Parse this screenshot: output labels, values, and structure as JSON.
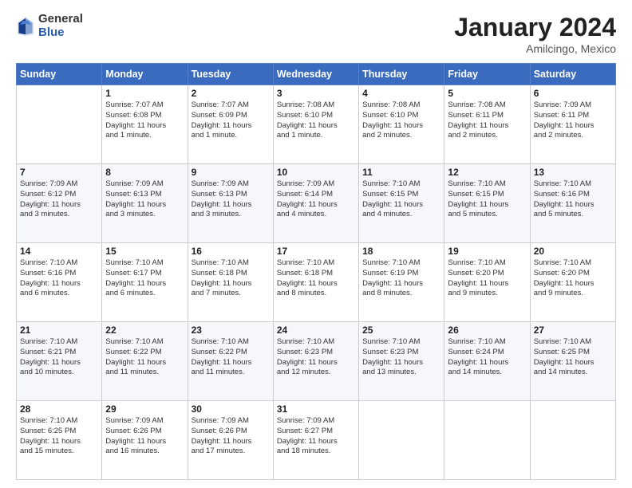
{
  "header": {
    "logo_general": "General",
    "logo_blue": "Blue",
    "main_title": "January 2024",
    "sub_title": "Amilcingo, Mexico"
  },
  "calendar": {
    "headers": [
      "Sunday",
      "Monday",
      "Tuesday",
      "Wednesday",
      "Thursday",
      "Friday",
      "Saturday"
    ],
    "weeks": [
      [
        {
          "day": "",
          "info": ""
        },
        {
          "day": "1",
          "info": "Sunrise: 7:07 AM\nSunset: 6:08 PM\nDaylight: 11 hours\nand 1 minute."
        },
        {
          "day": "2",
          "info": "Sunrise: 7:07 AM\nSunset: 6:09 PM\nDaylight: 11 hours\nand 1 minute."
        },
        {
          "day": "3",
          "info": "Sunrise: 7:08 AM\nSunset: 6:10 PM\nDaylight: 11 hours\nand 1 minute."
        },
        {
          "day": "4",
          "info": "Sunrise: 7:08 AM\nSunset: 6:10 PM\nDaylight: 11 hours\nand 2 minutes."
        },
        {
          "day": "5",
          "info": "Sunrise: 7:08 AM\nSunset: 6:11 PM\nDaylight: 11 hours\nand 2 minutes."
        },
        {
          "day": "6",
          "info": "Sunrise: 7:09 AM\nSunset: 6:11 PM\nDaylight: 11 hours\nand 2 minutes."
        }
      ],
      [
        {
          "day": "7",
          "info": "Sunrise: 7:09 AM\nSunset: 6:12 PM\nDaylight: 11 hours\nand 3 minutes."
        },
        {
          "day": "8",
          "info": "Sunrise: 7:09 AM\nSunset: 6:13 PM\nDaylight: 11 hours\nand 3 minutes."
        },
        {
          "day": "9",
          "info": "Sunrise: 7:09 AM\nSunset: 6:13 PM\nDaylight: 11 hours\nand 3 minutes."
        },
        {
          "day": "10",
          "info": "Sunrise: 7:09 AM\nSunset: 6:14 PM\nDaylight: 11 hours\nand 4 minutes."
        },
        {
          "day": "11",
          "info": "Sunrise: 7:10 AM\nSunset: 6:15 PM\nDaylight: 11 hours\nand 4 minutes."
        },
        {
          "day": "12",
          "info": "Sunrise: 7:10 AM\nSunset: 6:15 PM\nDaylight: 11 hours\nand 5 minutes."
        },
        {
          "day": "13",
          "info": "Sunrise: 7:10 AM\nSunset: 6:16 PM\nDaylight: 11 hours\nand 5 minutes."
        }
      ],
      [
        {
          "day": "14",
          "info": "Sunrise: 7:10 AM\nSunset: 6:16 PM\nDaylight: 11 hours\nand 6 minutes."
        },
        {
          "day": "15",
          "info": "Sunrise: 7:10 AM\nSunset: 6:17 PM\nDaylight: 11 hours\nand 6 minutes."
        },
        {
          "day": "16",
          "info": "Sunrise: 7:10 AM\nSunset: 6:18 PM\nDaylight: 11 hours\nand 7 minutes."
        },
        {
          "day": "17",
          "info": "Sunrise: 7:10 AM\nSunset: 6:18 PM\nDaylight: 11 hours\nand 8 minutes."
        },
        {
          "day": "18",
          "info": "Sunrise: 7:10 AM\nSunset: 6:19 PM\nDaylight: 11 hours\nand 8 minutes."
        },
        {
          "day": "19",
          "info": "Sunrise: 7:10 AM\nSunset: 6:20 PM\nDaylight: 11 hours\nand 9 minutes."
        },
        {
          "day": "20",
          "info": "Sunrise: 7:10 AM\nSunset: 6:20 PM\nDaylight: 11 hours\nand 9 minutes."
        }
      ],
      [
        {
          "day": "21",
          "info": "Sunrise: 7:10 AM\nSunset: 6:21 PM\nDaylight: 11 hours\nand 10 minutes."
        },
        {
          "day": "22",
          "info": "Sunrise: 7:10 AM\nSunset: 6:22 PM\nDaylight: 11 hours\nand 11 minutes."
        },
        {
          "day": "23",
          "info": "Sunrise: 7:10 AM\nSunset: 6:22 PM\nDaylight: 11 hours\nand 11 minutes."
        },
        {
          "day": "24",
          "info": "Sunrise: 7:10 AM\nSunset: 6:23 PM\nDaylight: 11 hours\nand 12 minutes."
        },
        {
          "day": "25",
          "info": "Sunrise: 7:10 AM\nSunset: 6:23 PM\nDaylight: 11 hours\nand 13 minutes."
        },
        {
          "day": "26",
          "info": "Sunrise: 7:10 AM\nSunset: 6:24 PM\nDaylight: 11 hours\nand 14 minutes."
        },
        {
          "day": "27",
          "info": "Sunrise: 7:10 AM\nSunset: 6:25 PM\nDaylight: 11 hours\nand 14 minutes."
        }
      ],
      [
        {
          "day": "28",
          "info": "Sunrise: 7:10 AM\nSunset: 6:25 PM\nDaylight: 11 hours\nand 15 minutes."
        },
        {
          "day": "29",
          "info": "Sunrise: 7:09 AM\nSunset: 6:26 PM\nDaylight: 11 hours\nand 16 minutes."
        },
        {
          "day": "30",
          "info": "Sunrise: 7:09 AM\nSunset: 6:26 PM\nDaylight: 11 hours\nand 17 minutes."
        },
        {
          "day": "31",
          "info": "Sunrise: 7:09 AM\nSunset: 6:27 PM\nDaylight: 11 hours\nand 18 minutes."
        },
        {
          "day": "",
          "info": ""
        },
        {
          "day": "",
          "info": ""
        },
        {
          "day": "",
          "info": ""
        }
      ]
    ]
  }
}
